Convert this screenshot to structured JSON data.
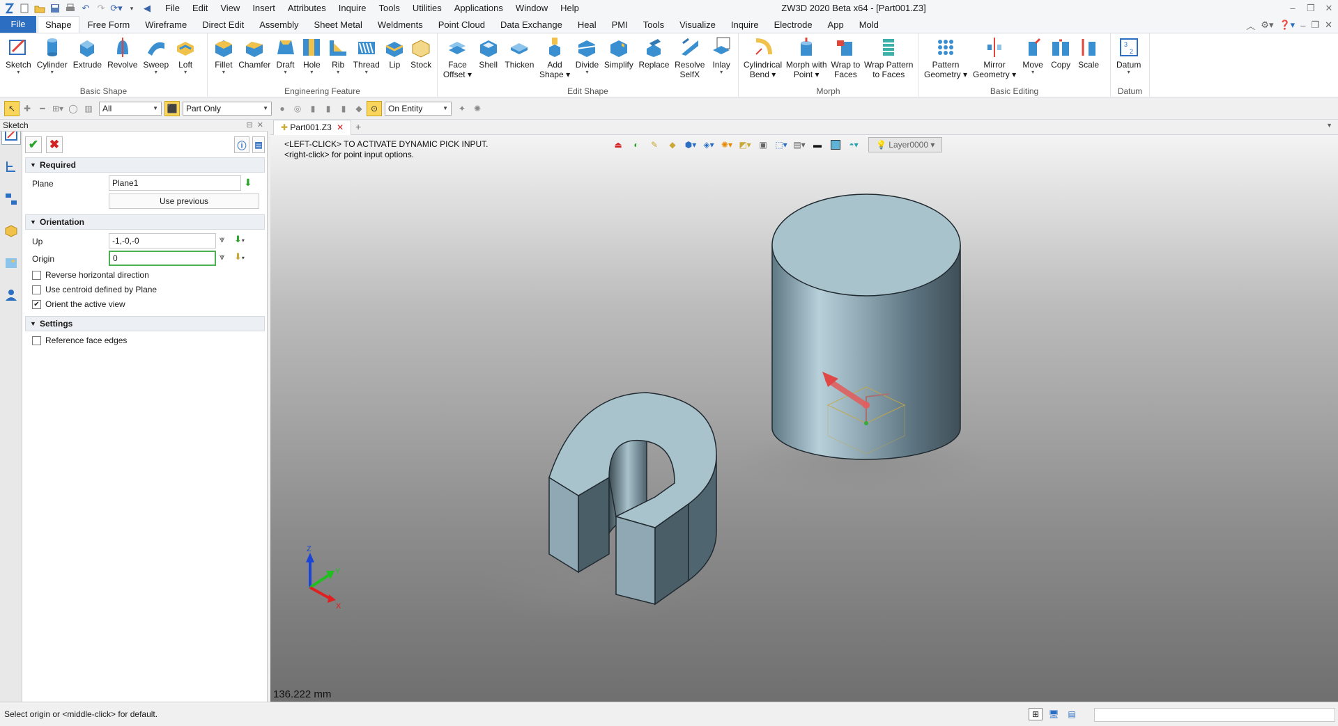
{
  "app": {
    "window_title": "ZW3D 2020 Beta x64 - [Part001.Z3]",
    "menu": [
      "File",
      "Edit",
      "View",
      "Insert",
      "Attributes",
      "Inquire",
      "Tools",
      "Utilities",
      "Applications",
      "Window",
      "Help"
    ]
  },
  "ribbon_tabs": [
    "Shape",
    "Free Form",
    "Wireframe",
    "Direct Edit",
    "Assembly",
    "Sheet Metal",
    "Weldments",
    "Point Cloud",
    "Data Exchange",
    "Heal",
    "PMI",
    "Tools",
    "Visualize",
    "Inquire",
    "Electrode",
    "App",
    "Mold"
  ],
  "file_tab": "File",
  "ribbon": {
    "basic_shape": {
      "label": "Basic Shape",
      "buttons": [
        "Sketch",
        "Cylinder",
        "Extrude",
        "Revolve",
        "Sweep",
        "Loft"
      ]
    },
    "engineering_feature": {
      "label": "Engineering Feature",
      "buttons": [
        "Fillet",
        "Chamfer",
        "Draft",
        "Hole",
        "Rib",
        "Thread",
        "Lip",
        "Stock"
      ]
    },
    "edit_shape": {
      "label": "Edit Shape",
      "buttons": [
        [
          "Face",
          "Offset"
        ],
        [
          "Shell"
        ],
        [
          "Thicken"
        ],
        [
          "Add",
          "Shape"
        ],
        [
          "Divide"
        ],
        [
          "Simplify"
        ],
        [
          "Replace"
        ],
        [
          "Resolve",
          "SelfX"
        ],
        [
          "Inlay"
        ]
      ]
    },
    "morph": {
      "label": "Morph",
      "buttons": [
        [
          "Cylindrical",
          "Bend"
        ],
        [
          "Morph with",
          "Point"
        ],
        [
          "Wrap to",
          "Faces"
        ],
        [
          "Wrap Pattern",
          "to Faces"
        ]
      ]
    },
    "basic_editing": {
      "label": "Basic Editing",
      "buttons": [
        [
          "Pattern",
          "Geometry"
        ],
        [
          "Mirror",
          "Geometry"
        ],
        [
          "Move"
        ],
        [
          "Copy"
        ],
        [
          "Scale"
        ]
      ]
    },
    "datum": {
      "label": "Datum",
      "buttons": [
        "Datum"
      ]
    }
  },
  "toolbar2": {
    "filter_value": "All",
    "scope_value": "Part Only",
    "pick_value": "On Entity"
  },
  "panel": {
    "title": "Sketch",
    "required": {
      "header": "Required",
      "plane_label": "Plane",
      "plane_value": "Plane1",
      "use_previous": "Use previous"
    },
    "orientation": {
      "header": "Orientation",
      "up_label": "Up",
      "up_value": "-1,-0,-0",
      "origin_label": "Origin",
      "origin_value": "0",
      "reverse_label": "Reverse horizontal direction",
      "reverse_checked": false,
      "centroid_label": "Use centroid defined by Plane",
      "centroid_checked": false,
      "orient_label": "Orient the active view",
      "orient_checked": true
    },
    "settings": {
      "header": "Settings",
      "ref_edges_label": "Reference face edges",
      "ref_edges_checked": false
    }
  },
  "document": {
    "tab": "Part001.Z3",
    "hint_line1": "<LEFT-CLICK> TO ACTIVATE DYNAMIC PICK INPUT.",
    "hint_line2": "<right-click> for point input options.",
    "layer": "Layer0000",
    "measure": "136.222 mm",
    "axis_x": "X",
    "axis_y": "Y",
    "axis_z": "Z"
  },
  "status": {
    "text": "Select origin or <middle-click> for default."
  },
  "colors": {
    "accent": "#2c6fc2",
    "solid_light": "#a9c3cd",
    "solid_dark": "#4a5e68",
    "ok_green": "#2aa52a",
    "cancel_red": "#d32020"
  }
}
